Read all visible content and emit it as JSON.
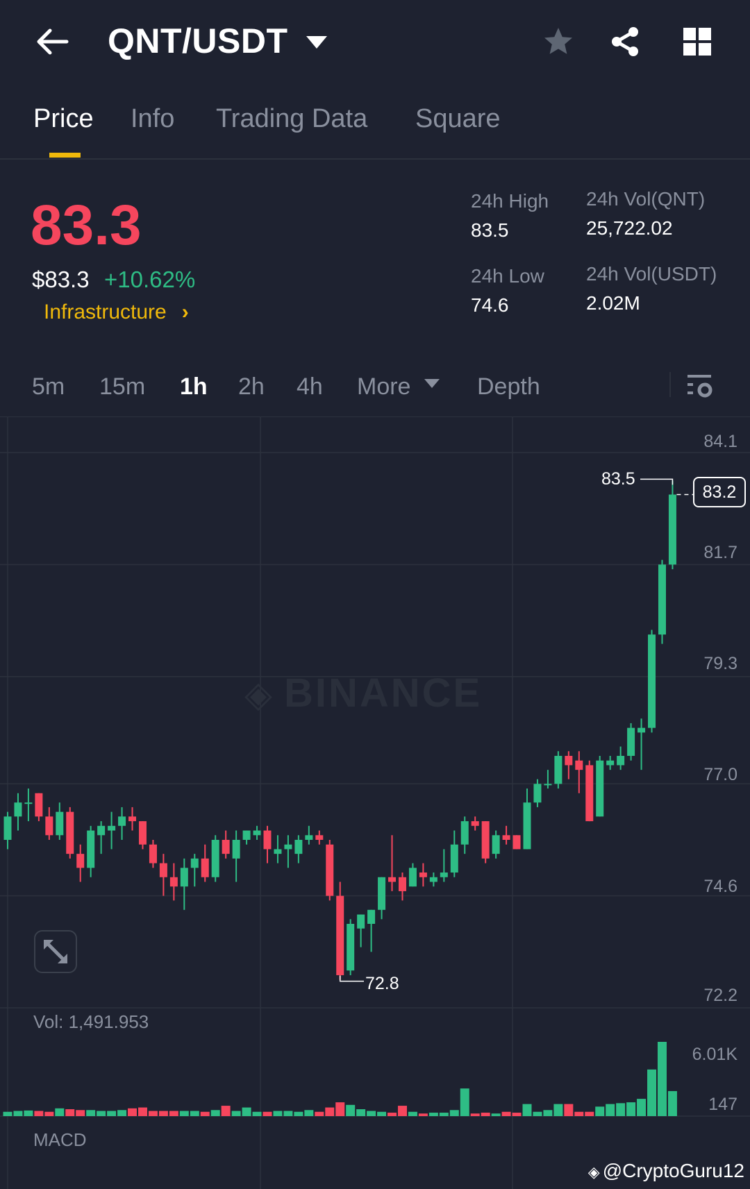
{
  "header": {
    "title": "QNT/USDT",
    "icons": [
      "back-arrow-icon",
      "dropdown-icon",
      "star-icon",
      "share-icon",
      "grid-icon"
    ]
  },
  "tabs": [
    {
      "label": "Price",
      "active": true
    },
    {
      "label": "Info"
    },
    {
      "label": "Trading Data"
    },
    {
      "label": "Square"
    }
  ],
  "ticker": {
    "last_price": "83.3",
    "usd_price": "$83.3",
    "change": "+10.62%",
    "sector": "Infrastructure",
    "sector_chevron": "›",
    "stats": {
      "high_label": "24h High",
      "high": "83.5",
      "low_label": "24h Low",
      "low": "74.6",
      "vol_qnt_label": "24h Vol(QNT)",
      "vol_qnt": "25,722.02",
      "vol_usdt_label": "24h Vol(USDT)",
      "vol_usdt": "2.02M"
    }
  },
  "timeframes": [
    {
      "label": "5m"
    },
    {
      "label": "15m"
    },
    {
      "label": "1h",
      "active": true
    },
    {
      "label": "2h"
    },
    {
      "label": "4h"
    },
    {
      "label": "More"
    },
    {
      "label": "Depth"
    }
  ],
  "colors": {
    "up": "#2ebd85",
    "down": "#f6465d",
    "accent": "#f0b90b",
    "bg": "#1e2230"
  },
  "chart": {
    "watermark": "BINANCE",
    "vol_label": "Vol: 1,491.953",
    "macd_label": "MACD",
    "credit": "@CryptoGuru12"
  },
  "chart_data": {
    "type": "candlestick",
    "interval": "1h",
    "y_ticks": [
      "84.1",
      "81.7",
      "79.3",
      "77.0",
      "74.6",
      "72.2"
    ],
    "ylim": [
      72.2,
      84.1
    ],
    "high_marker": "83.5",
    "low_marker": "72.8",
    "current_marker": "83.2",
    "vol_ticks": [
      "6.01K",
      "147"
    ],
    "ohlc": [
      [
        75.8,
        76.4,
        75.6,
        76.3
      ],
      [
        76.3,
        76.8,
        76.0,
        76.6
      ],
      [
        76.6,
        76.9,
        76.2,
        76.6
      ],
      [
        76.8,
        76.8,
        76.2,
        76.3
      ],
      [
        76.3,
        76.5,
        75.8,
        75.9
      ],
      [
        75.9,
        76.6,
        75.8,
        76.4
      ],
      [
        76.4,
        76.5,
        75.4,
        75.5
      ],
      [
        75.5,
        75.7,
        74.9,
        75.2
      ],
      [
        75.2,
        76.1,
        75.0,
        76.0
      ],
      [
        75.9,
        76.2,
        75.5,
        76.1
      ],
      [
        76.0,
        76.4,
        75.6,
        76.1
      ],
      [
        76.1,
        76.5,
        75.8,
        76.3
      ],
      [
        76.3,
        76.5,
        76.0,
        76.2
      ],
      [
        76.2,
        76.2,
        75.6,
        75.7
      ],
      [
        75.7,
        75.8,
        75.2,
        75.3
      ],
      [
        75.3,
        75.5,
        74.6,
        75.0
      ],
      [
        75.0,
        75.3,
        74.5,
        74.8
      ],
      [
        74.8,
        75.4,
        74.3,
        75.2
      ],
      [
        75.2,
        75.5,
        74.8,
        75.4
      ],
      [
        75.4,
        75.7,
        74.9,
        75.0
      ],
      [
        75.0,
        75.9,
        74.9,
        75.8
      ],
      [
        75.8,
        76.0,
        75.4,
        75.5
      ],
      [
        75.4,
        76.0,
        74.9,
        75.8
      ],
      [
        75.8,
        76.0,
        75.7,
        76.0
      ],
      [
        75.9,
        76.1,
        75.8,
        76.0
      ],
      [
        76.0,
        76.1,
        75.3,
        75.6
      ],
      [
        75.5,
        75.9,
        75.3,
        75.6
      ],
      [
        75.6,
        75.9,
        75.2,
        75.7
      ],
      [
        75.5,
        75.9,
        75.3,
        75.8
      ],
      [
        75.8,
        76.1,
        75.7,
        75.9
      ],
      [
        75.9,
        76.0,
        75.7,
        75.8
      ],
      [
        75.7,
        75.8,
        74.5,
        74.6
      ],
      [
        74.6,
        74.9,
        72.8,
        72.9
      ],
      [
        73.0,
        74.1,
        72.9,
        74.0
      ],
      [
        73.9,
        74.2,
        73.5,
        74.2
      ],
      [
        74.0,
        74.3,
        73.4,
        74.3
      ],
      [
        74.3,
        75.0,
        74.1,
        75.0
      ],
      [
        75.0,
        75.9,
        74.7,
        74.9
      ],
      [
        75.0,
        75.1,
        74.5,
        74.7
      ],
      [
        74.8,
        75.3,
        74.8,
        75.2
      ],
      [
        75.1,
        75.3,
        74.8,
        75.0
      ],
      [
        74.9,
        75.1,
        74.8,
        75.0
      ],
      [
        75.0,
        75.6,
        74.9,
        75.1
      ],
      [
        75.1,
        76.0,
        75.0,
        75.7
      ],
      [
        75.7,
        76.3,
        75.5,
        76.2
      ],
      [
        76.2,
        76.3,
        76.0,
        76.1
      ],
      [
        76.2,
        76.2,
        75.3,
        75.4
      ],
      [
        75.5,
        76.0,
        75.4,
        75.9
      ],
      [
        75.9,
        76.1,
        75.7,
        75.8
      ],
      [
        75.9,
        75.9,
        75.6,
        75.6
      ],
      [
        75.6,
        76.9,
        75.6,
        76.6
      ],
      [
        76.6,
        77.1,
        76.5,
        77.0
      ],
      [
        77.0,
        77.3,
        76.9,
        77.0
      ],
      [
        77.0,
        77.7,
        76.9,
        77.6
      ],
      [
        77.6,
        77.7,
        77.1,
        77.4
      ],
      [
        77.5,
        77.7,
        76.8,
        77.3
      ],
      [
        77.4,
        77.5,
        76.2,
        76.2
      ],
      [
        76.3,
        77.6,
        76.3,
        77.5
      ],
      [
        77.4,
        77.6,
        77.3,
        77.5
      ],
      [
        77.4,
        77.8,
        77.3,
        77.6
      ],
      [
        77.6,
        78.3,
        77.5,
        78.2
      ],
      [
        78.1,
        78.4,
        77.3,
        78.2
      ],
      [
        78.2,
        80.3,
        78.1,
        80.2
      ],
      [
        80.2,
        81.8,
        80.0,
        81.7
      ],
      [
        81.7,
        83.5,
        81.6,
        83.2
      ]
    ],
    "volume": [
      500,
      600,
      650,
      600,
      500,
      900,
      800,
      700,
      700,
      600,
      600,
      700,
      900,
      1000,
      600,
      600,
      600,
      600,
      600,
      500,
      700,
      1200,
      600,
      1000,
      500,
      500,
      600,
      600,
      500,
      700,
      500,
      1000,
      1600,
      1300,
      800,
      600,
      500,
      400,
      1200,
      500,
      300,
      400,
      400,
      700,
      3200,
      300,
      400,
      300,
      500,
      400,
      1400,
      500,
      700,
      1400,
      1400,
      500,
      500,
      1100,
      1400,
      1500,
      1600,
      2000,
      5400,
      8600,
      2900
    ]
  }
}
